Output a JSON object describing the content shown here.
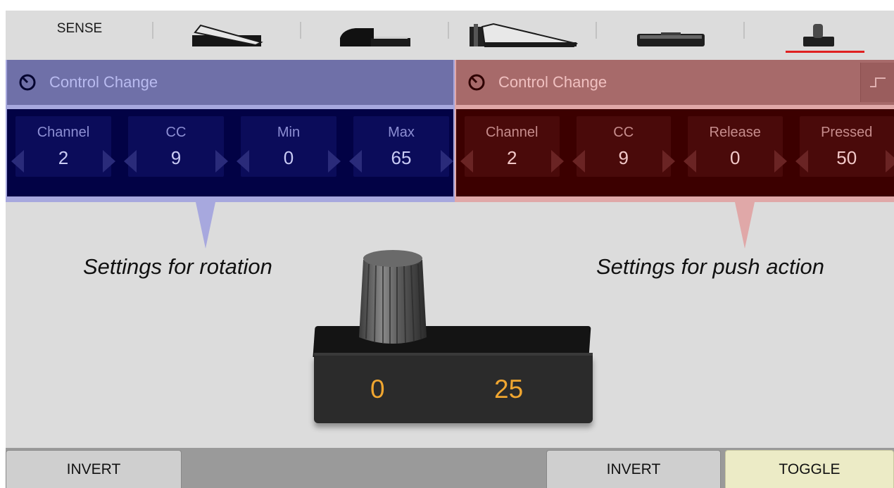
{
  "tabs": [
    {
      "label": "SENSE",
      "icon": "sense-label"
    },
    {
      "label": "",
      "icon": "expression-pedal-icon"
    },
    {
      "label": "",
      "icon": "sustain-pedal-icon"
    },
    {
      "label": "",
      "icon": "volume-pedal-icon"
    },
    {
      "label": "",
      "icon": "footswitch-icon"
    },
    {
      "label": "",
      "icon": "knob-controller-icon",
      "selected": true
    }
  ],
  "rotation_panel": {
    "mode": "Control Change",
    "fields": [
      {
        "label": "Channel",
        "value": "2"
      },
      {
        "label": "CC",
        "value": "9"
      },
      {
        "label": "Min",
        "value": "0"
      },
      {
        "label": "Max",
        "value": "65"
      }
    ],
    "caption": "Settings for rotation"
  },
  "push_panel": {
    "mode": "Control Change",
    "fields": [
      {
        "label": "Channel",
        "value": "2"
      },
      {
        "label": "CC",
        "value": "9"
      },
      {
        "label": "Release",
        "value": "0"
      },
      {
        "label": "Pressed",
        "value": "50"
      }
    ],
    "caption": "Settings for push action"
  },
  "device": {
    "value_left": "0",
    "value_right": "25"
  },
  "bottom": {
    "invert_left": "INVERT",
    "invert_right": "INVERT",
    "toggle": "TOGGLE"
  },
  "colors": {
    "rotation_accent": "#6f70a8",
    "rotation_body": "#020245",
    "push_accent": "#a76a6a",
    "push_body": "#3c0000",
    "selected_underline": "#e02020",
    "device_value": "#f0a630",
    "toggle_active": "#ecebc6"
  }
}
